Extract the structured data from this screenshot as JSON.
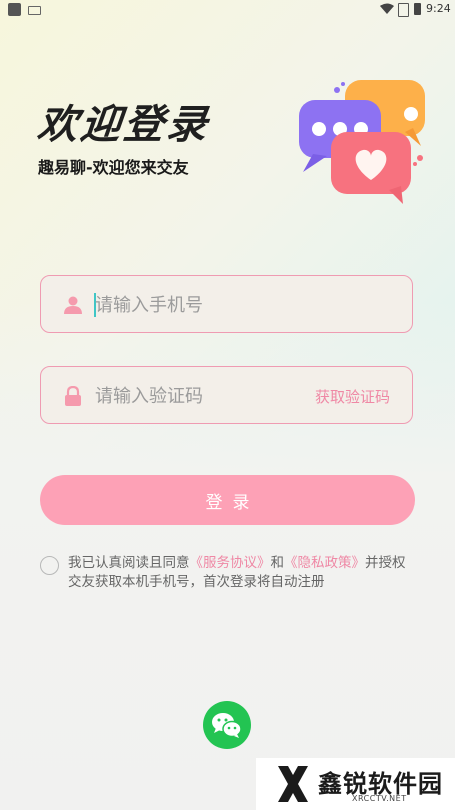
{
  "status_bar": {
    "time": "9:24",
    "icons": [
      "app-icon",
      "keyboard-icon",
      "wifi-icon",
      "sim-icon",
      "battery-icon"
    ]
  },
  "header": {
    "title": "欢迎登录",
    "subtitle": "趣易聊-欢迎您来交友",
    "illustration": "chat-bubbles-heart"
  },
  "form": {
    "phone_placeholder": "请输入手机号",
    "code_placeholder": "请输入验证码",
    "get_code_label": "获取验证码",
    "login_label": "登录"
  },
  "agreement": {
    "text_part1": "我已认真阅读且同意",
    "service_link": "《服务协议》",
    "text_and": "和",
    "privacy_link": "《隐私政策》",
    "text_part2": "并授权交友获取本机手机号，首次登录将自动注册",
    "checked": false
  },
  "social_login": {
    "icon": "wechat-icon"
  },
  "watermark": {
    "brand": "鑫锐软件园",
    "domain": "XRCCTV.NET"
  },
  "colors": {
    "accent_pink": "#fda1b6",
    "link_pink": "#ef88a5",
    "wechat_green": "#23c452"
  }
}
